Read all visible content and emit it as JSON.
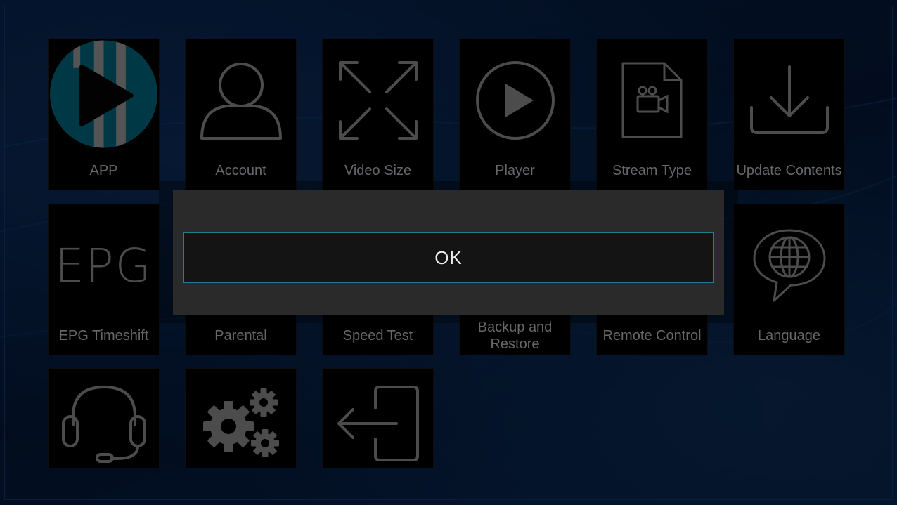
{
  "menu": {
    "tiles": [
      {
        "label": "APP",
        "icon": "app-logo-icon"
      },
      {
        "label": "Account",
        "icon": "account-icon"
      },
      {
        "label": "Video Size",
        "icon": "expand-arrows-icon"
      },
      {
        "label": "Player",
        "icon": "play-circle-icon"
      },
      {
        "label": "Stream Type",
        "icon": "video-file-icon"
      },
      {
        "label": "Update Contents",
        "icon": "download-icon"
      },
      {
        "label": "EPG Timeshift",
        "icon": "epg-text-icon",
        "icon_text": "EPG"
      },
      {
        "label": "Parental",
        "icon": "parental-icon"
      },
      {
        "label": "Speed Test",
        "icon": "speed-test-icon"
      },
      {
        "label": "Backup and\nRestore",
        "icon": "backup-icon"
      },
      {
        "label": "Remote Control",
        "icon": "remote-icon"
      },
      {
        "label": "Language",
        "icon": "globe-speech-icon"
      },
      {
        "label": "",
        "icon": "headset-icon"
      },
      {
        "label": "",
        "icon": "gears-icon"
      },
      {
        "label": "",
        "icon": "exit-icon"
      }
    ]
  },
  "dialog": {
    "ok_label": "OK"
  },
  "colors": {
    "app_logo_blue": "#00677f",
    "app_logo_grey": "#9a9a9a",
    "icon_grey": "#8a8a8a",
    "button_border": "#1f7f8a"
  }
}
